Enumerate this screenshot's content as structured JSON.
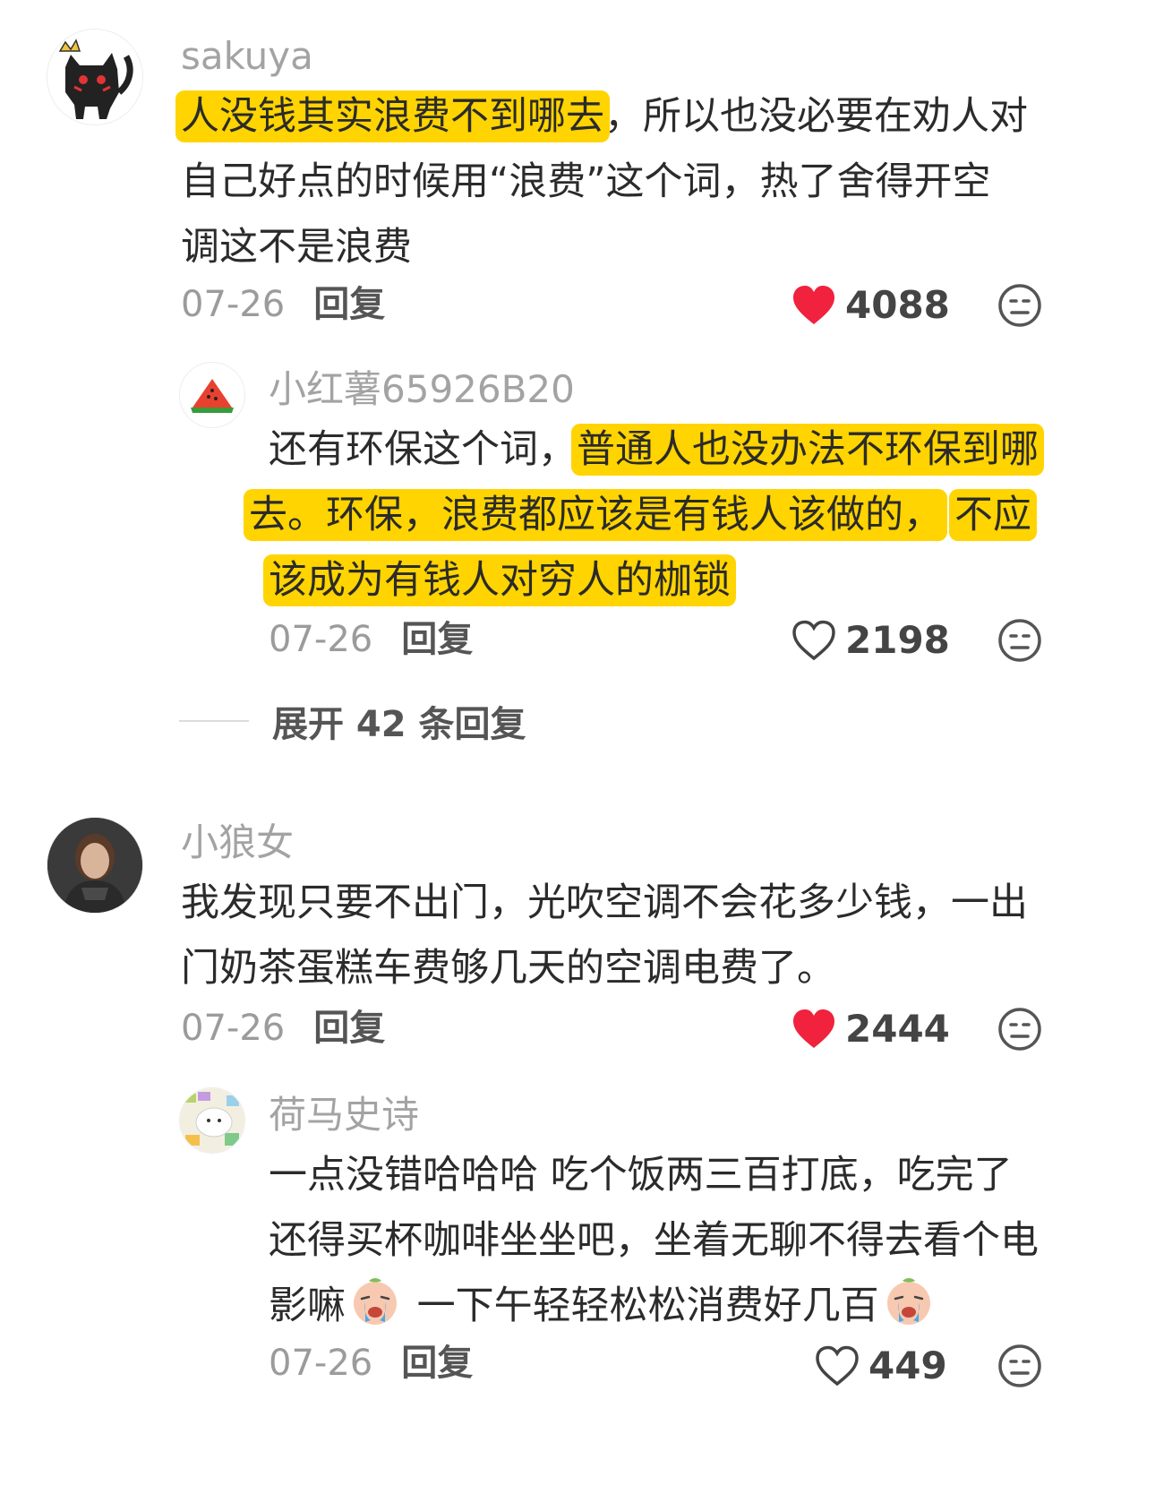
{
  "comments": [
    {
      "username": "sakuya",
      "avatar_icon": "black-cat-with-crown-icon",
      "lines": [
        {
          "hl": "人没钱其实浪费不到哪去",
          "rest": "，所以也没必要在劝人对"
        },
        {
          "text": "自己好点的时候用“浪费”这个词，热了舍得开空"
        },
        {
          "text": "调这不是浪费"
        }
      ],
      "date": "07-26",
      "reply_label": "回复",
      "likes": "4088",
      "liked": true
    },
    {
      "username": "小红薯65926B20",
      "avatar_icon": "watermelon-icon",
      "line1_plain": "还有环保这个词，",
      "line1_hl": "普通人也没办法不环保到哪",
      "line2_hl1": "去。环保，浪费都应该是有钱人该做的，",
      "line2_hl2": "不应",
      "line3_hl": "该成为有钱人对穷人的枷锁",
      "date": "07-26",
      "reply_label": "回复",
      "likes": "2198",
      "liked": false
    },
    {
      "username": "小狼女",
      "avatar_icon": "portrait-girl-icon",
      "lines": [
        "我发现只要不出门，光吹空调不会花多少钱，一出",
        "门奶茶蛋糕车费够几天的空调电费了。"
      ],
      "date": "07-26",
      "reply_label": "回复",
      "likes": "2444",
      "liked": true
    },
    {
      "username": "荷马史诗",
      "avatar_icon": "colorful-sticker-avatar-icon",
      "line1": "一点没错哈哈哈 吃个饭两三百打底，吃完了",
      "line2": "还得买杯咖啡坐坐吧，坐着无聊不得去看个电",
      "line3_a": "影嘛",
      "line3_b": " 一下午轻轻松松消费好几百",
      "emoji_icon": "crying-face-emoji",
      "date": "07-26",
      "reply_label": "回复",
      "likes": "449",
      "liked": false
    }
  ],
  "expand_replies": "展开 42 条回复",
  "colors": {
    "highlight": "#ffd400",
    "heart": "#f0223d",
    "username": "#a3a3a3"
  }
}
